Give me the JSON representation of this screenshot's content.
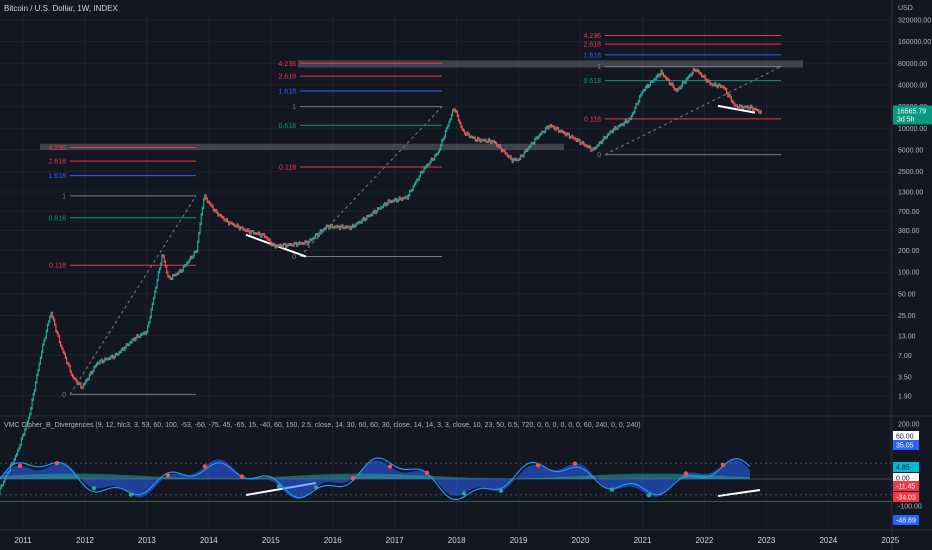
{
  "header": {
    "symbol": "Bitcoin / U.S. Dollar, 1W, INDEX",
    "currency": "USD"
  },
  "colors": {
    "background": "#131722",
    "grid": "#1e222d",
    "up": "#26a69a",
    "down": "#ef5350",
    "fib_red": "#f23645",
    "fib_blue": "#2962ff",
    "fib_green": "#089981",
    "fib_gray": "#787b86",
    "price_tag": "#089981",
    "wave_line": "#2196f3",
    "area_blue": "#2962ff",
    "money_flow": "#26a69a"
  },
  "chart_data": [
    {
      "type": "line",
      "name": "price",
      "scale": "log",
      "yticks": [
        "320000.00",
        "160000.00",
        "80000.00",
        "40000.00",
        "20000.00",
        "10000.00",
        "5000.00",
        "2500.00",
        "1300.00",
        "700.00",
        "380.00",
        "200.00",
        "100.00",
        "50.00",
        "25.00",
        "13.00",
        "7.00",
        "3.50",
        "1.90"
      ],
      "xticks": [
        "2011",
        "2012",
        "2013",
        "2014",
        "2015",
        "2016",
        "2017",
        "2018",
        "2019",
        "2020",
        "2021",
        "2022",
        "2023",
        "2024",
        "2025"
      ],
      "x": [
        2010.55,
        2010.9,
        2011.1,
        2011.3,
        2011.45,
        2011.6,
        2011.8,
        2011.95,
        2012.2,
        2012.5,
        2012.8,
        2013.0,
        2013.25,
        2013.35,
        2013.55,
        2013.8,
        2013.92,
        2014.1,
        2014.3,
        2014.6,
        2014.9,
        2015.05,
        2015.3,
        2015.6,
        2015.9,
        2016.3,
        2016.6,
        2016.9,
        2017.2,
        2017.45,
        2017.7,
        2017.96,
        2018.1,
        2018.3,
        2018.6,
        2018.9,
        2019.0,
        2019.3,
        2019.5,
        2019.9,
        2020.2,
        2020.5,
        2020.8,
        2021.0,
        2021.3,
        2021.55,
        2021.85,
        2022.1,
        2022.3,
        2022.5,
        2022.75,
        2022.92
      ],
      "y": [
        0.07,
        0.3,
        1.0,
        8,
        28,
        10,
        3.5,
        2.5,
        5.5,
        7,
        12,
        15,
        180,
        80,
        105,
        200,
        1150,
        700,
        500,
        380,
        320,
        230,
        240,
        260,
        430,
        420,
        620,
        950,
        1100,
        2600,
        4600,
        19500,
        9000,
        7000,
        6500,
        3600,
        3700,
        7500,
        11000,
        7200,
        5000,
        9200,
        13500,
        33000,
        60000,
        33000,
        67000,
        41000,
        38000,
        20000,
        19500,
        16565.79
      ],
      "last_price": "16565.79",
      "countdown": "3d 5h"
    },
    {
      "type": "line",
      "name": "VMC Cipher_B_Divergences (9, 12, hlc3, 3, 53, 60, 100, -53, -60, -75, 45, -65, 15, -40, 60, 150, 2.5, close, 14, 30, 60, 60, 30, close, 14, 14, 3, 3, close, 10, 23, 50, 0.5, 720, 0, 0, 0, 0, 0, 0, 60, 240, 0, 0, 240)",
      "yticks": [
        "200.00",
        "60.00",
        "35.05",
        "4.85",
        "0.00",
        "-11.45",
        "-34.03",
        "-48.69",
        "-100.00"
      ],
      "value_tags": [
        "60.00",
        "35.05",
        "4.85",
        "0.00",
        "-11.45",
        "-34.03",
        "-48.69"
      ]
    }
  ],
  "fib_sets": [
    {
      "levels": [
        {
          "label": "4.236",
          "price": 5400
        },
        {
          "label": "2.618",
          "price": 3500
        },
        {
          "label": "1.618",
          "price": 2200
        },
        {
          "label": "1",
          "price": 1150
        },
        {
          "label": "0.618",
          "price": 570
        },
        {
          "label": "0.118",
          "price": 125
        },
        {
          "label": "0",
          "price": 2.0
        }
      ]
    },
    {
      "levels": [
        {
          "label": "4.236",
          "price": 80000
        },
        {
          "label": "2.618",
          "price": 53000
        },
        {
          "label": "1.618",
          "price": 33000
        },
        {
          "label": "1",
          "price": 20000
        },
        {
          "label": "0.618",
          "price": 11000
        },
        {
          "label": "0.118",
          "price": 2900
        },
        {
          "label": "0",
          "price": 165
        }
      ]
    },
    {
      "levels": [
        {
          "label": "4.236",
          "price": 195000
        },
        {
          "label": "2.618",
          "price": 148000
        },
        {
          "label": "1.618",
          "price": 105000
        },
        {
          "label": "1",
          "price": 72000
        },
        {
          "label": "0.618",
          "price": 46000
        },
        {
          "label": "0.118",
          "price": 13500
        },
        {
          "label": "0",
          "price": 4300
        }
      ]
    }
  ]
}
